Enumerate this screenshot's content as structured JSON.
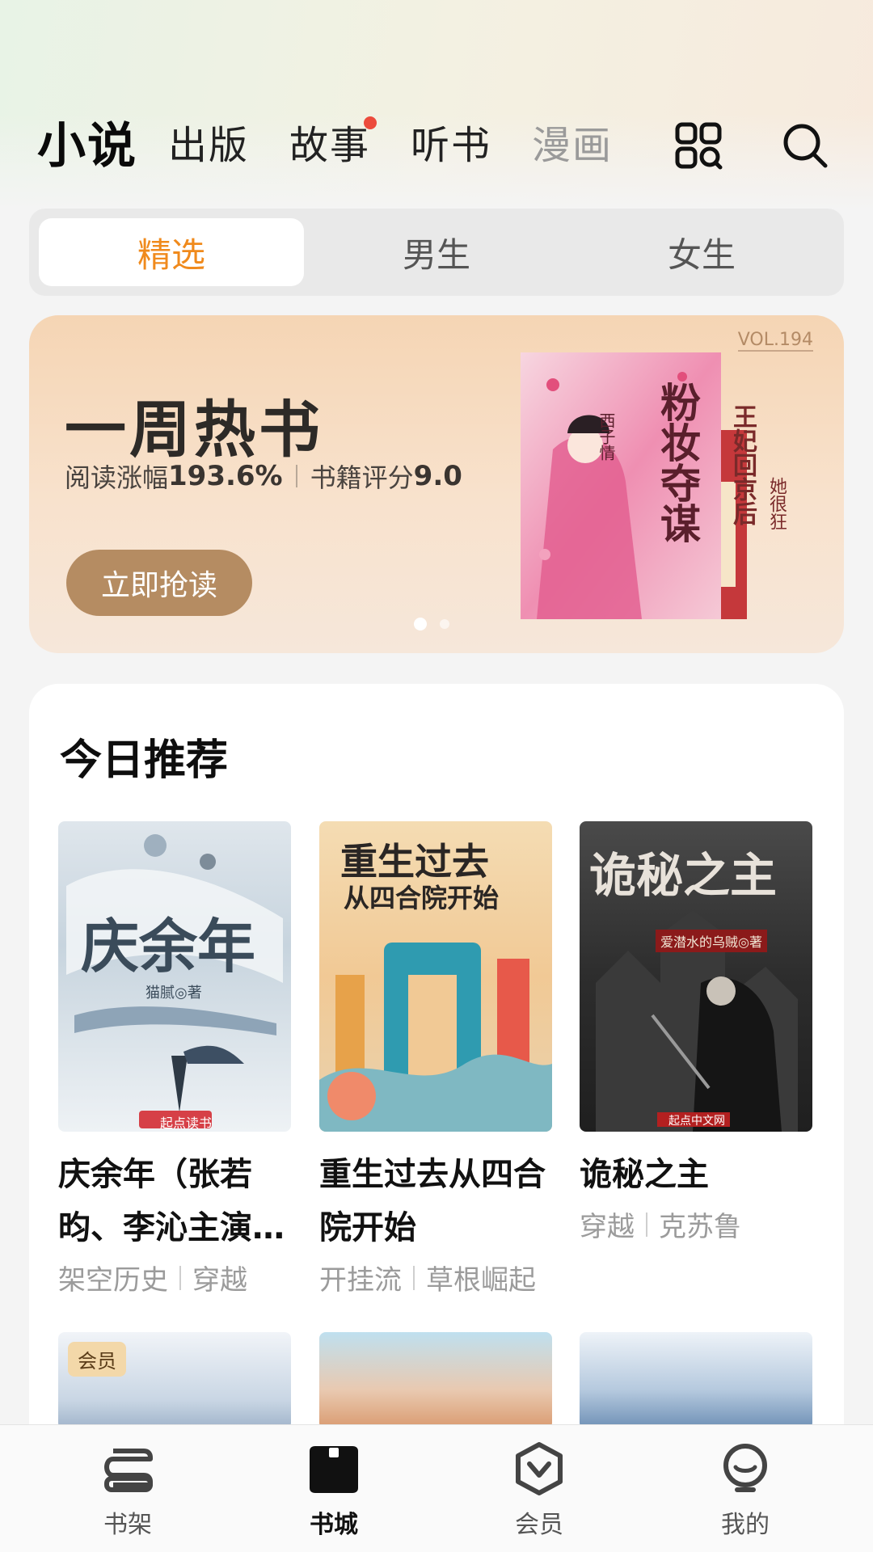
{
  "header": {
    "tabs": [
      {
        "label": "小说",
        "active": true
      },
      {
        "label": "出版"
      },
      {
        "label": "故事",
        "badge": "red-dot"
      },
      {
        "label": "听书"
      },
      {
        "label": "漫画"
      }
    ],
    "icons": [
      "grid-icon",
      "search-icon"
    ]
  },
  "segment": {
    "items": [
      "精选",
      "男生",
      "女生"
    ],
    "selected": "精选",
    "accent": "#f08a1c"
  },
  "banner": {
    "title": "一周热书",
    "stat1_label": "阅读涨幅",
    "stat1_value": "193.6%",
    "stat2_label": "书籍评分",
    "stat2_value": "9.0",
    "button": "立即抢读",
    "vol": "VOL.194",
    "book_titles": [
      "粉妆夺谋",
      "王妃回京后",
      "她很狂"
    ],
    "cover_author": "西子情",
    "page_count": 2,
    "current_page": 1
  },
  "recommend": {
    "title": "今日推荐",
    "books": [
      {
        "name": "庆余年（张若昀、李沁主演…",
        "tags": [
          "架空历史",
          "穿越"
        ],
        "cover_title": "庆余年",
        "cover_author": "猫腻◎著",
        "cover_publisher": "起点读书"
      },
      {
        "name": "重生过去从四合院开始",
        "tags": [
          "开挂流",
          "草根崛起"
        ],
        "cover_title_1": "重生过去",
        "cover_title_2": "从四合院开始"
      },
      {
        "name": "诡秘之主",
        "tags": [
          "穿越",
          "克苏鲁"
        ],
        "cover_title": "诡秘之主",
        "cover_author": "爱潜水的乌贼◎著",
        "cover_publisher": "起点中文网"
      }
    ],
    "next_row_badge": "会员"
  },
  "bottom_nav": {
    "items": [
      {
        "label": "书架",
        "icon": "bookshelf-icon"
      },
      {
        "label": "书城",
        "icon": "bookstore-icon",
        "active": true
      },
      {
        "label": "会员",
        "icon": "vip-icon"
      },
      {
        "label": "我的",
        "icon": "profile-icon"
      }
    ]
  }
}
